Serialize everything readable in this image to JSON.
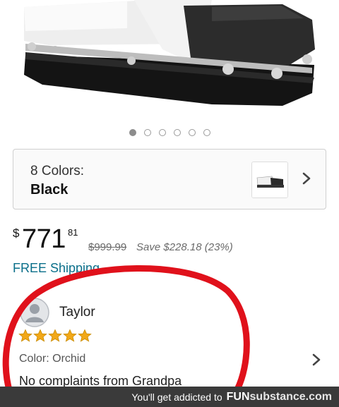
{
  "gallery": {
    "dot_count": 6,
    "active_index": 0
  },
  "variant": {
    "count_label": "8 Colors:",
    "selected": "Black"
  },
  "price": {
    "currency_symbol": "$",
    "whole": "771",
    "cents": "81",
    "list_price": "$999.99",
    "savings": "Save $228.18 (23%)"
  },
  "shipping": {
    "label": "FREE Shipping"
  },
  "review": {
    "reviewer": "Taylor",
    "rating": 5,
    "max_rating": 5,
    "color_label": "Color: Orchid",
    "text": "No complaints from Grandpa"
  },
  "watermark": {
    "tagline": "You'll get addicted to",
    "brand_fun": "FUN",
    "brand_rest": "substance.com"
  },
  "colors": {
    "link": "#0a6f8a",
    "star": "#f2a818",
    "highlight": "#e0111b",
    "watermark_bg": "#3a3a3a"
  }
}
